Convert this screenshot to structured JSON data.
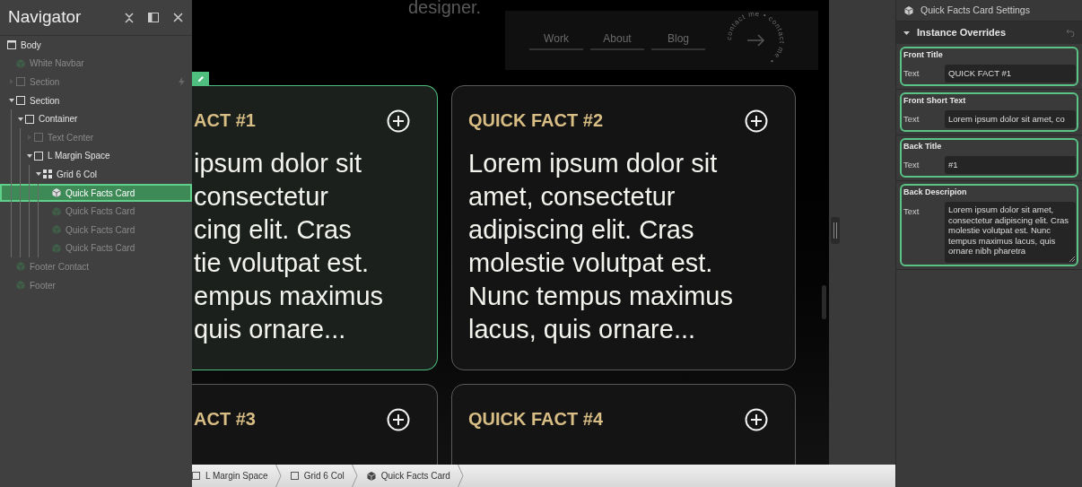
{
  "navigator": {
    "title": "Navigator",
    "tree": [
      {
        "label": "Body",
        "kind": "page",
        "dimmed": false,
        "selected": false,
        "children": [
          {
            "label": "White Navbar",
            "kind": "component",
            "dimmed": true,
            "selected": false
          },
          {
            "label": "Section",
            "kind": "box",
            "dimmed": true,
            "selected": false,
            "expanded": false,
            "interaction": true
          },
          {
            "label": "Section",
            "kind": "box",
            "dimmed": false,
            "selected": false,
            "expanded": true,
            "children": [
              {
                "label": "Container",
                "kind": "box",
                "dimmed": false,
                "selected": false,
                "expanded": true,
                "children": [
                  {
                    "label": "Text Center",
                    "kind": "box",
                    "dimmed": true,
                    "selected": false,
                    "expanded": false
                  },
                  {
                    "label": "L Margin Space",
                    "kind": "box",
                    "dimmed": false,
                    "selected": false,
                    "expanded": true,
                    "children": [
                      {
                        "label": "Grid 6 Col",
                        "kind": "grid",
                        "dimmed": false,
                        "selected": false,
                        "expanded": true,
                        "children": [
                          {
                            "label": "Quick Facts Card",
                            "kind": "component",
                            "dimmed": false,
                            "selected": true
                          },
                          {
                            "label": "Quick Facts Card",
                            "kind": "component",
                            "dimmed": true,
                            "selected": false
                          },
                          {
                            "label": "Quick Facts Card",
                            "kind": "component",
                            "dimmed": true,
                            "selected": false
                          },
                          {
                            "label": "Quick Facts Card",
                            "kind": "component",
                            "dimmed": true,
                            "selected": false
                          }
                        ]
                      }
                    ]
                  }
                ]
              }
            ]
          },
          {
            "label": "Footer Contact",
            "kind": "component",
            "dimmed": true,
            "selected": false
          },
          {
            "label": "Footer",
            "kind": "component",
            "dimmed": true,
            "selected": false
          }
        ]
      }
    ]
  },
  "canvas": {
    "heading": "designer.",
    "nav_links": [
      "Work",
      "About",
      "Blog"
    ],
    "contact_ring": "contact me • contact me •",
    "cards": [
      {
        "title": "ACT #1",
        "lines": [
          "ipsum dolor sit",
          "consectetur",
          "cing elit. Cras",
          "tie volutpat est.",
          "empus maximus",
          "quis ornare..."
        ],
        "selected": true
      },
      {
        "title": "QUICK FACT #2",
        "lines": [
          "Lorem ipsum dolor sit",
          "amet, consectetur",
          "adipiscing elit. Cras",
          "molestie volutpat est.",
          "Nunc tempus maximus",
          "lacus, quis ornare..."
        ],
        "selected": false
      },
      {
        "title": "ACT #3",
        "selected": false
      },
      {
        "title": "QUICK FACT #4",
        "selected": false
      }
    ]
  },
  "breadcrumbs": [
    {
      "label": "L Margin Space",
      "kind": "box"
    },
    {
      "label": "Grid 6 Col",
      "kind": "box"
    },
    {
      "label": "Quick Facts Card",
      "kind": "component"
    }
  ],
  "settings": {
    "title": "Quick Facts Card Settings",
    "section": "Instance Overrides",
    "expanded": true,
    "overrides": [
      {
        "label": "Front Title",
        "field_label": "Text",
        "value": "QUICK FACT #1",
        "kind": "input"
      },
      {
        "label": "Front Short Text",
        "field_label": "Text",
        "value": "Lorem ipsum dolor sit amet, co",
        "kind": "input"
      },
      {
        "label": "Back Title",
        "field_label": "Text",
        "value": "#1",
        "kind": "input"
      },
      {
        "label": "Back Descripion",
        "field_label": "Text",
        "value": "Lorem ipsum dolor sit amet, consectetur adipiscing elit. Cras molestie volutpat est. Nunc tempus maximus lacus, quis ornare nibh pharetra",
        "kind": "textarea"
      }
    ]
  }
}
